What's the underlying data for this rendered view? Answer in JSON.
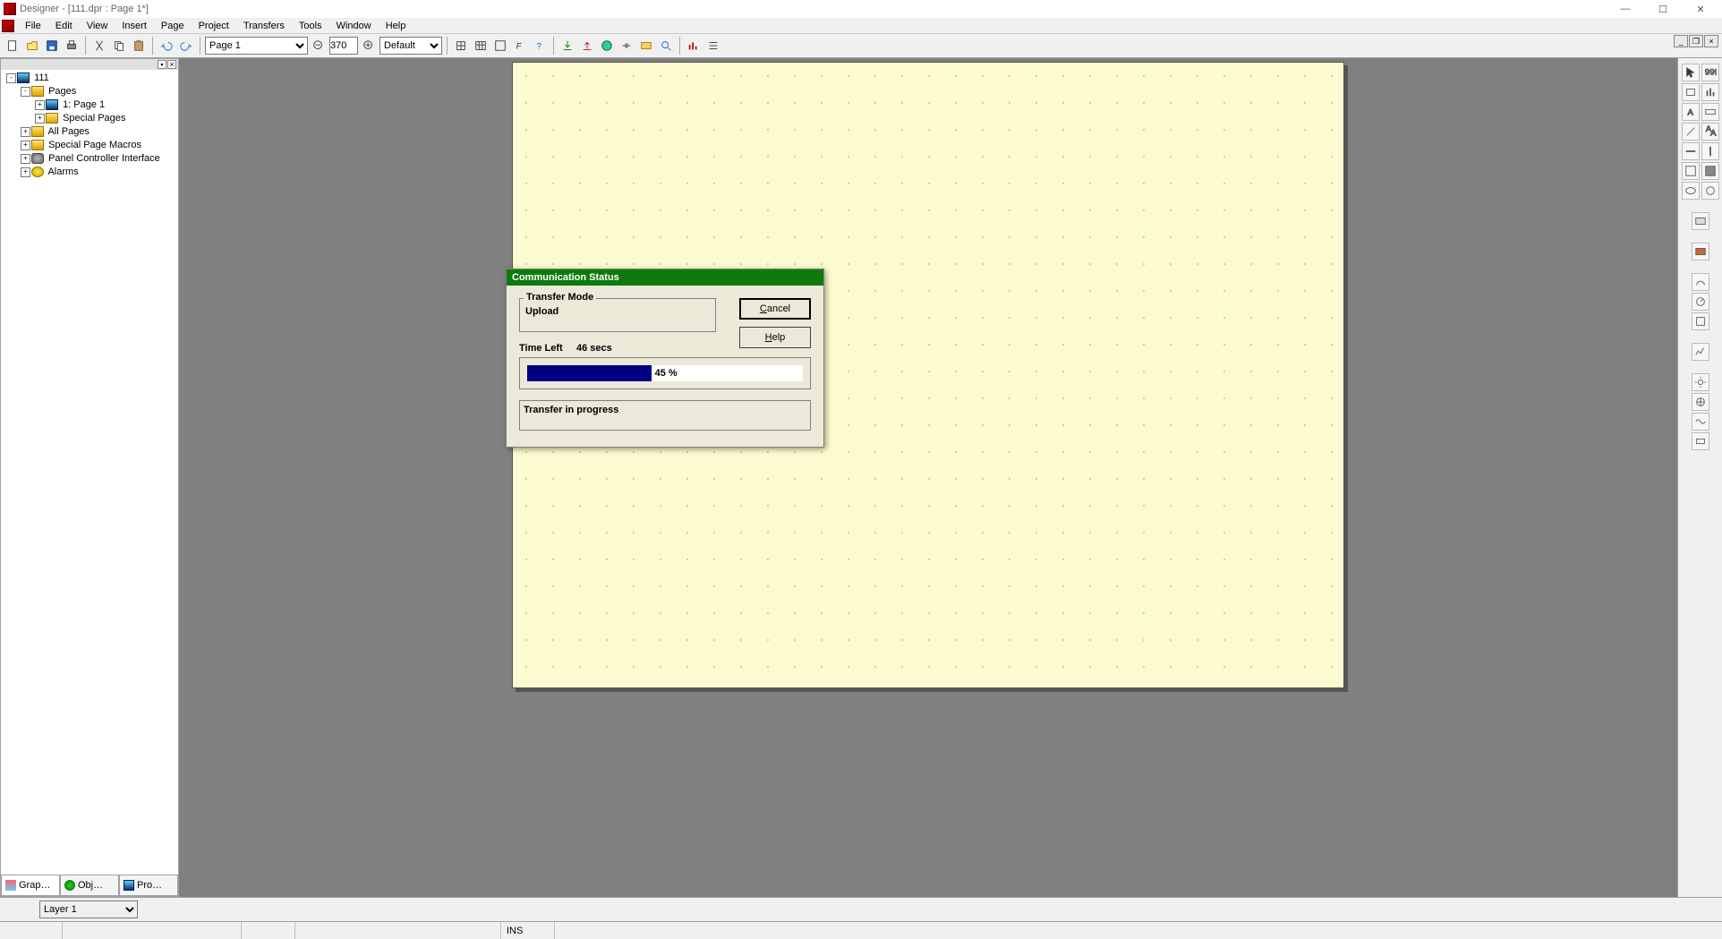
{
  "window": {
    "title": "Designer - [111.dpr : Page 1*]"
  },
  "menu": {
    "items": [
      "File",
      "Edit",
      "View",
      "Insert",
      "Page",
      "Project",
      "Transfers",
      "Tools",
      "Window",
      "Help"
    ]
  },
  "toolbar": {
    "page_selector": "Page 1",
    "zoom_value": "370",
    "style_selector": "Default"
  },
  "tree": {
    "root": "111",
    "nodes": {
      "pages": "Pages",
      "page1": "1: Page 1",
      "special_pages": "Special Pages",
      "all_pages": "All Pages",
      "special_macros": "Special Page Macros",
      "panel_interface": "Panel  Controller Interface",
      "alarms": "Alarms"
    }
  },
  "left_tabs": {
    "tab1": "Grap…",
    "tab2": "Obj…",
    "tab3": "Pro…"
  },
  "dialog": {
    "title": "Communication Status",
    "transfer_mode_label": "Transfer Mode",
    "transfer_mode_value": "Upload",
    "time_left_label": "Time Left",
    "time_left_value": "46 secs",
    "progress_percent": 45,
    "progress_label": "45 %",
    "status_text": "Transfer in progress",
    "cancel_label": "Cancel",
    "help_label": "Help"
  },
  "bottom": {
    "layer_selector": "Layer 1"
  },
  "status": {
    "ins": "INS"
  }
}
